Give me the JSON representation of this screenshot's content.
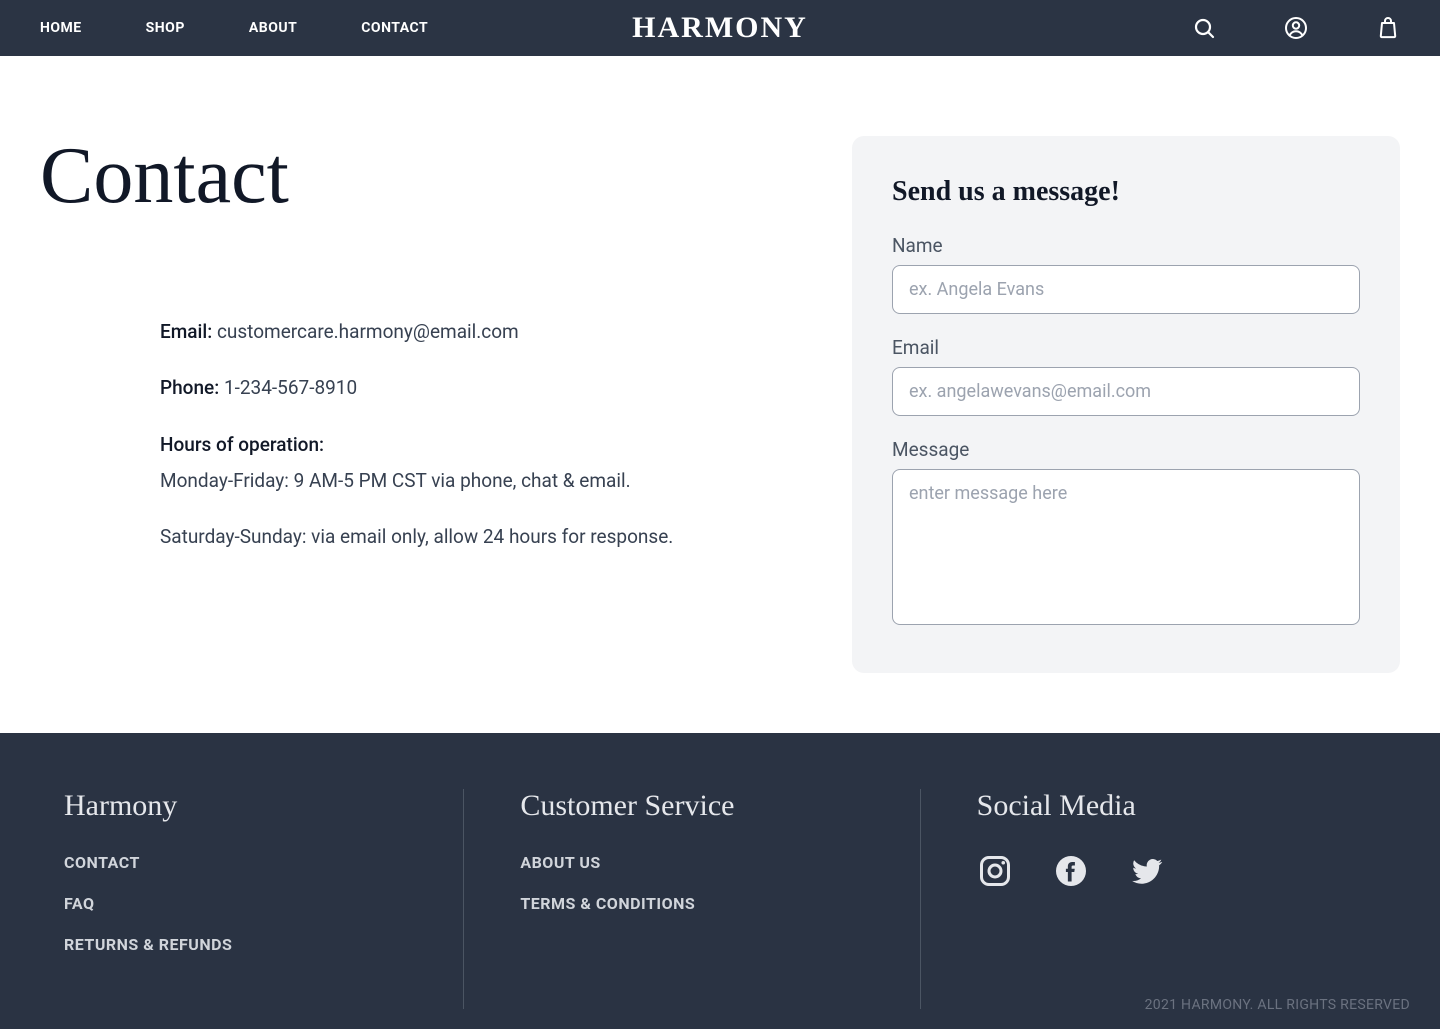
{
  "brand": "HARMONY",
  "nav": {
    "items": [
      "HOME",
      "SHOP",
      "ABOUT",
      "CONTACT"
    ]
  },
  "icons": {
    "search": "search-icon",
    "account": "user-circle-icon",
    "bag": "shopping-bag-icon"
  },
  "page": {
    "title": "Contact",
    "email_label": "Email:",
    "email_value": "customercare.harmony@email.com",
    "phone_label": "Phone:",
    "phone_value": "1-234-567-8910",
    "hours_label": "Hours of operation:",
    "hours_line1": "Monday-Friday: 9 AM-5 PM CST via phone, chat & email.",
    "hours_line2": "Saturday-Sunday: via email only, allow 24 hours for response."
  },
  "form": {
    "title": "Send us a message!",
    "name_label": "Name",
    "name_placeholder": "ex. Angela Evans",
    "email_label": "Email",
    "email_placeholder": "ex. angelawevans@email.com",
    "message_label": "Message",
    "message_placeholder": "enter message here"
  },
  "footer": {
    "col1": {
      "heading": "Harmony",
      "links": [
        "CONTACT",
        "FAQ",
        "RETURNS & REFUNDS"
      ]
    },
    "col2": {
      "heading": "Customer Service",
      "links": [
        "ABOUT US",
        "TERMS & CONDITIONS"
      ]
    },
    "col3": {
      "heading": "Social Media"
    },
    "copyright": "2021 HARMONY. ALL RIGHTS RESERVED"
  }
}
